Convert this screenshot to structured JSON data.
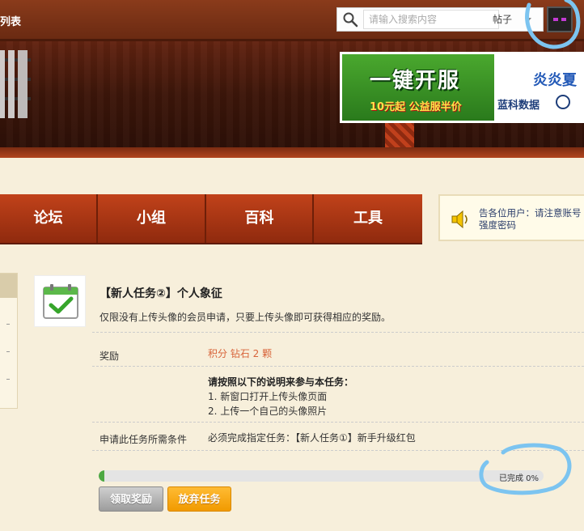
{
  "header": {
    "nav_list_text": "列表",
    "search": {
      "placeholder": "请输入搜索内容",
      "type_selected": "帖子"
    }
  },
  "ad": {
    "title": "一键开服",
    "subtitle": "10元起 公益服半价",
    "right_title": "炎炎夏",
    "right_brand": "蓝科数据"
  },
  "nav": {
    "items": [
      {
        "label": "论坛"
      },
      {
        "label": "小组"
      },
      {
        "label": "百科"
      },
      {
        "label": "工具"
      }
    ]
  },
  "notice": {
    "text": "告各位用户：请注意账号强度密码"
  },
  "task": {
    "title": "【新人任务②】个人象征",
    "description": "仅限没有上传头像的会员申请，只要上传头像即可获得相应的奖励。",
    "reward_label": "奖励",
    "reward_value": "积分 钻石 2 颗",
    "instructions_heading": "请按照以下的说明来参与本任务：",
    "instructions": [
      "1. 新窗口打开上传头像页面",
      "2. 上传一个自己的头像照片"
    ],
    "condition_label": "申请此任务所需条件",
    "condition_value": "必须完成指定任务：【新人任务①】新手升级红包",
    "progress_text": "已完成 0%",
    "progress_fraction": 0,
    "claim_button": "领取奖励",
    "abandon_button": "放弃任务"
  },
  "colors": {
    "nav_red": "#b23a16",
    "reward_orange": "#d8643a",
    "progress_green": "#4da843",
    "abandon_orange": "#f5a300",
    "annotation_blue": "#7cc4f0"
  }
}
